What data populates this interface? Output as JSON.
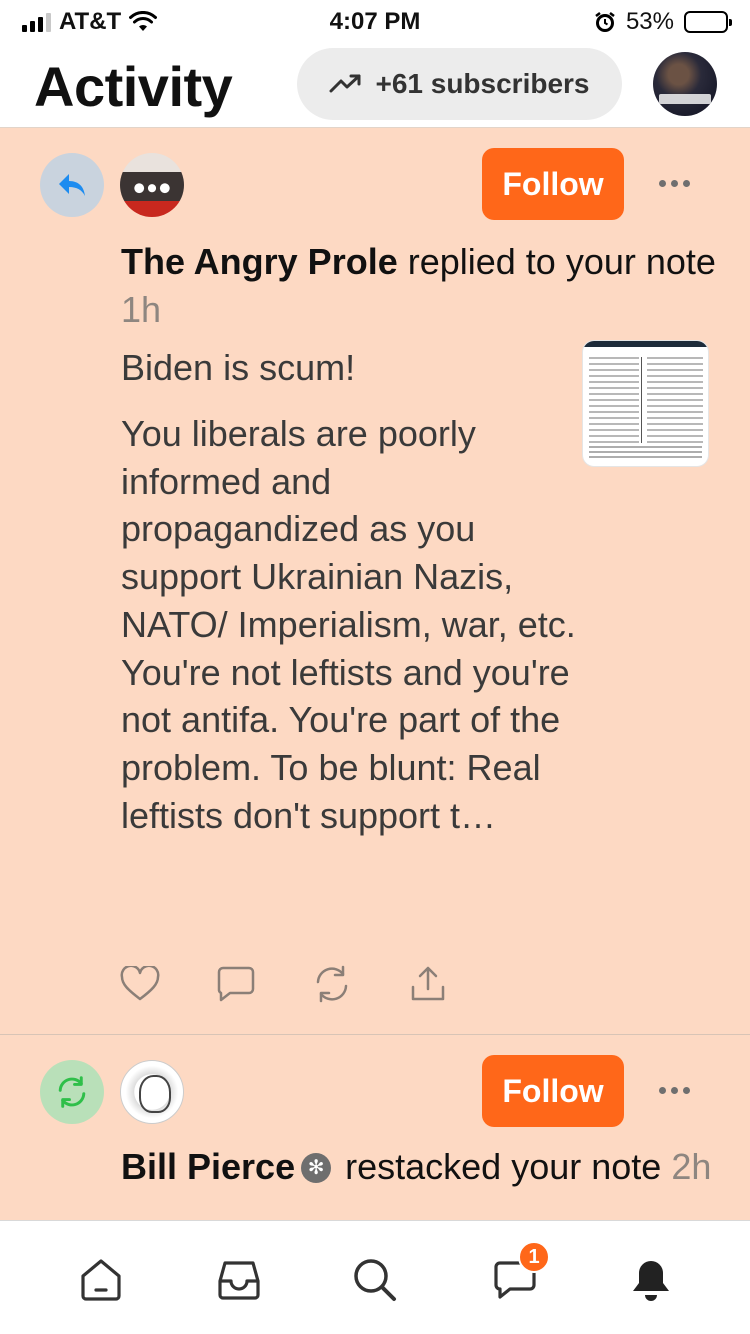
{
  "status_bar": {
    "carrier": "AT&T",
    "time": "4:07 PM",
    "battery": "53%",
    "icons": [
      "signal-icon",
      "wifi-icon",
      "alarm-icon",
      "battery-icon"
    ]
  },
  "header": {
    "title": "Activity",
    "subscribers_pill": "+61 subscribers",
    "pill_icon": "trending-up-icon"
  },
  "feed": [
    {
      "action": "reply",
      "badge_icon": "reply-arrow-icon",
      "follow_label": "Follow",
      "name": "The Angry Prole",
      "action_text": "replied to your note",
      "time": "1h",
      "note_first": "Biden is scum!",
      "note_body": "You liberals are poorly informed and propagandized as you support Ukrainian Nazis, NATO/ Imperialism, war, etc. You're not leftists and you're not antifa. You're part of the problem. To be blunt: Real leftists don't support t…",
      "engage_icons": [
        "heart-icon",
        "comment-icon",
        "restack-icon",
        "share-icon"
      ]
    },
    {
      "action": "restack",
      "badge_icon": "restack-icon",
      "follow_label": "Follow",
      "name": "Bill Pierce",
      "action_text": "restacked your note",
      "time": "2h"
    }
  ],
  "tab_bar": {
    "tabs": [
      "home-icon",
      "inbox-icon",
      "search-icon",
      "chat-icon",
      "bell-icon"
    ],
    "chat_badge": "1"
  },
  "colors": {
    "accent": "#ff6719",
    "feed_bg": "#fdd9c3",
    "reply_badge": "#c9d3de",
    "restack_badge": "#b9e0b9"
  }
}
